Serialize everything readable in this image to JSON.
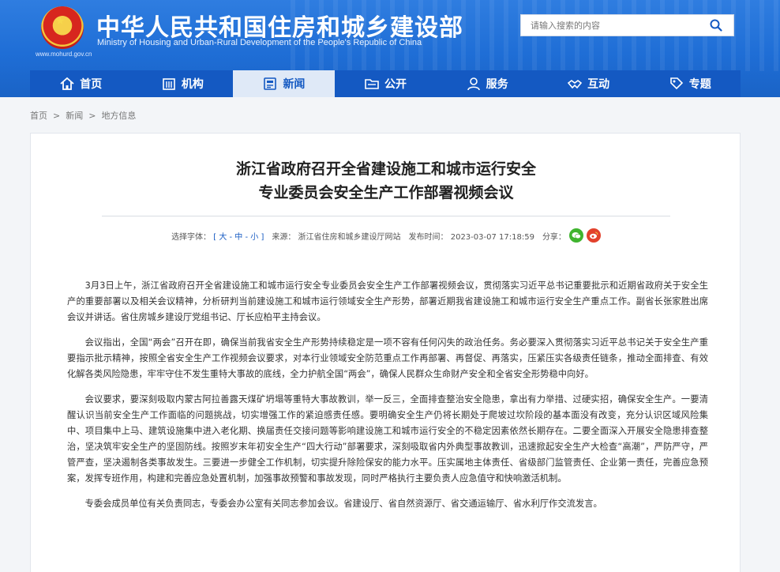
{
  "header": {
    "title": "中华人民共和国住房和城乡建设部",
    "subtitle": "Ministry of Housing and Urban-Rural Development of the People's Republic of China",
    "url": "www.mohurd.gov.cn",
    "search_placeholder": "请输入搜索的内容"
  },
  "nav": [
    {
      "label": "首页",
      "icon": "home-icon"
    },
    {
      "label": "机构",
      "icon": "building-icon"
    },
    {
      "label": "新闻",
      "icon": "news-icon",
      "active": true
    },
    {
      "label": "公开",
      "icon": "folder-icon"
    },
    {
      "label": "服务",
      "icon": "person-service-icon"
    },
    {
      "label": "互动",
      "icon": "handshake-icon"
    },
    {
      "label": "专题",
      "icon": "tag-icon"
    }
  ],
  "breadcrumb": [
    "首页",
    "新闻",
    "地方信息"
  ],
  "article": {
    "title_line1": "浙江省政府召开全省建设施工和城市运行安全",
    "title_line2": "专业委员会安全生产工作部署视频会议",
    "font_size_label": "选择字体：",
    "font_sizes": "[ 大 - 中 - 小 ]",
    "source_label": "来源：",
    "source": "浙江省住房和城乡建设厅网站",
    "date_label": "发布时间：",
    "date": "2023-03-07 17:18:59",
    "share_label": "分享：",
    "paragraphs": [
      "3月3日上午，浙江省政府召开全省建设施工和城市运行安全专业委员会安全生产工作部署视频会议，贯彻落实习近平总书记重要批示和近期省政府关于安全生产的重要部署以及相关会议精神，分析研判当前建设施工和城市运行领域安全生产形势，部署近期我省建设施工和城市运行安全生产重点工作。副省长张家胜出席会议并讲话。省住房城乡建设厅党组书记、厅长应柏平主持会议。",
      "会议指出，全国“两会”召开在即，确保当前我省安全生产形势持续稳定是一项不容有任何闪失的政治任务。务必要深入贯彻落实习近平总书记关于安全生产重要指示批示精神，按照全省安全生产工作视频会议要求，对本行业领域安全防范重点工作再部署、再督促、再落实，压紧压实各级责任链条，推动全面排查、有效化解各类风险隐患，牢牢守住不发生重特大事故的底线，全力护航全国“两会”，确保人民群众生命财产安全和全省安全形势稳中向好。",
      "会议要求，要深刻吸取内蒙古阿拉善露天煤矿坍塌等重特大事故教训，举一反三，全面排查整治安全隐患，拿出有力举措、过硬实招，确保安全生产。一要清醒认识当前安全生产工作面临的问题挑战，切实增强工作的紧迫感责任感。要明确安全生产仍将长期处于爬坡过坎阶段的基本面没有改变，充分认识区域风险集中、项目集中上马、建筑设施集中进入老化期、换届责任交接问题等影响建设施工和城市运行安全的不稳定因素依然长期存在。二要全面深入开展安全隐患排查整治，坚决筑牢安全生产的坚固防线。按照岁末年初安全生产“四大行动”部署要求，深刻吸取省内外典型事故教训，迅速掀起安全生产大检查“高潮”，严防严守，严管严查，坚决遏制各类事故发生。三要进一步健全工作机制，切实提升除险保安的能力水平。压实属地主体责任、省级部门监管责任、企业第一责任，完善应急预案，发挥专班作用，构建和完善应急处置机制，加强事故预警和事故发现，同时严格执行主要负责人应急值守和快响激活机制。",
      "专委会成员单位有关负责同志，专委会办公室有关同志参加会议。省建设厅、省自然资源厅、省交通运输厅、省水利厅作交流发言。"
    ]
  },
  "colors": {
    "header_blue": "#1f6ed6",
    "nav_blue": "#1459c2",
    "wechat_green": "#3fb42e",
    "weibo_red": "#e2412c"
  }
}
